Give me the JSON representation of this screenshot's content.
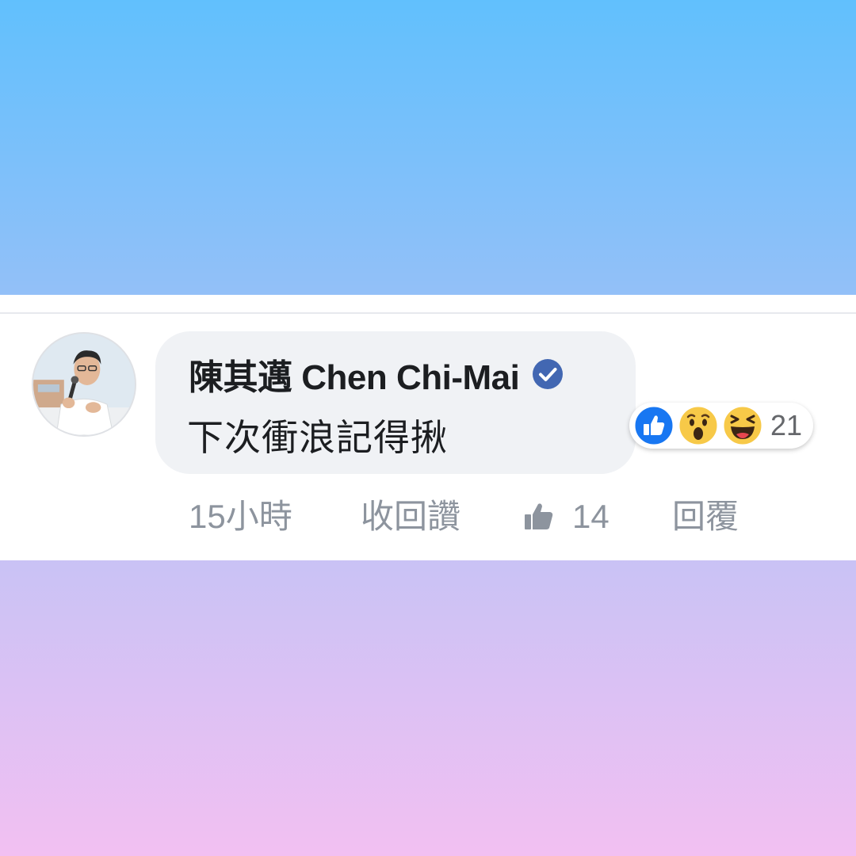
{
  "comment": {
    "author": "陳其邁 Chen Chi-Mai",
    "text": "下次衝浪記得揪",
    "reaction_count": "21",
    "reaction_icons": [
      "like-icon",
      "wow-icon",
      "haha-icon"
    ],
    "verified_color": "#4267b2"
  },
  "actions": {
    "timestamp": "15小時",
    "unlike_label": "收回讚",
    "like_count": "14",
    "reply_label": "回覆"
  },
  "colors": {
    "top_gradient": [
      "#61c0fd",
      "#93c0f8"
    ],
    "bottom_gradient": [
      "#c9c2f5",
      "#f2c0f2"
    ],
    "like_blue": "#1877f2",
    "reaction_yellow": "#f7c948"
  }
}
